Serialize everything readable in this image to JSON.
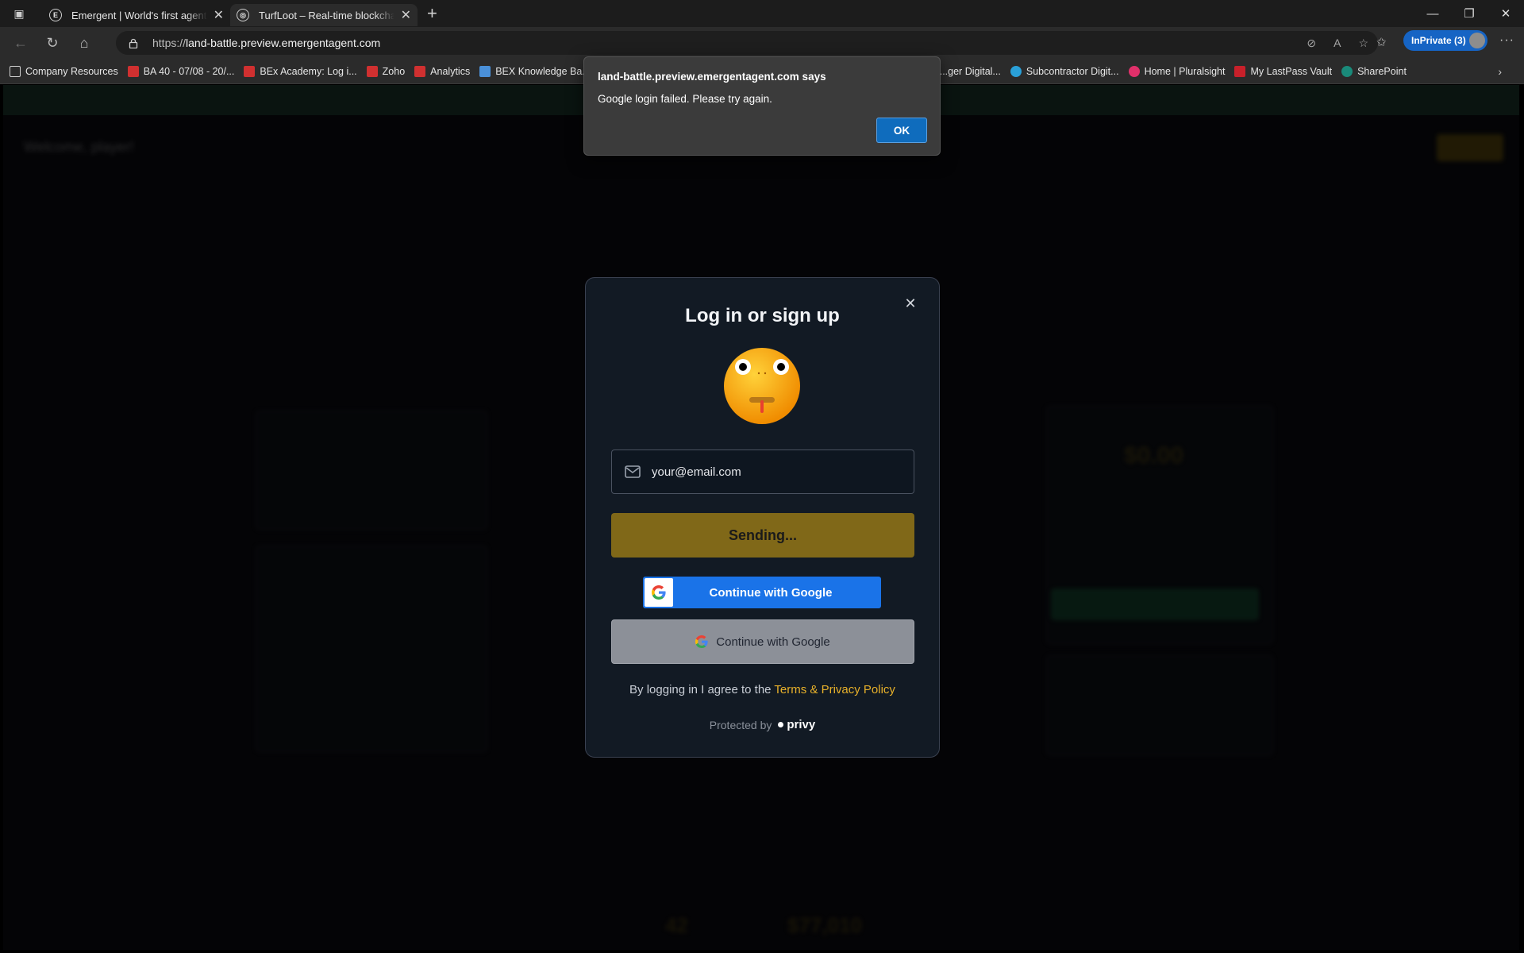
{
  "browser": {
    "tabs": [
      {
        "title": "Emergent | World's first agentic vibe-coding platform",
        "favicon": "E"
      },
      {
        "title": "TurfLoot – Real-time blockchain skill game",
        "favicon": "globe"
      }
    ],
    "url_prefix": "https://",
    "url_host": "land-battle.preview.emergentagent.com",
    "inprivate_label": "InPrivate (3)",
    "bookmarks": [
      {
        "label": "Company Resources",
        "color": "#d0d0d0"
      },
      {
        "label": "BA 40 - 07/08 - 20/...",
        "color": "#d03030"
      },
      {
        "label": "BEx Academy: Log i...",
        "color": "#d03030"
      },
      {
        "label": "Zoho",
        "color": "#d03030"
      },
      {
        "label": "Analytics",
        "color": "#d03030"
      },
      {
        "label": "BEX Knowledge Ba...",
        "color": "#4a90d9"
      },
      {
        "label": "...ger Digital...",
        "color": "#2b2b2b"
      },
      {
        "label": "Subcontractor Digit...",
        "color": "#2aa0d8"
      },
      {
        "label": "Home | Pluralsight",
        "color": "#e0306a"
      },
      {
        "label": "My LastPass Vault",
        "color": "#c8202a"
      },
      {
        "label": "SharePoint",
        "color": "#1a8a7a"
      }
    ]
  },
  "alert": {
    "header": "land-battle.preview.emergentagent.com says",
    "message": "Google login failed. Please try again.",
    "ok_label": "OK"
  },
  "modal": {
    "title": "Log in or sign up",
    "email_placeholder": "your@email.com",
    "submit_label": "Sending...",
    "google_button_primary": "Continue with Google",
    "google_button_secondary": "Continue with Google",
    "terms_prefix": "By logging in I agree to the ",
    "terms_link": "Terms & Privacy Policy",
    "protected_by": "Protected by",
    "brand": "privy"
  },
  "background": {
    "welcome": "Welcome, player!",
    "stat_left": "42",
    "stat_right": "$77,010",
    "wallet_balance": "$0.00"
  }
}
